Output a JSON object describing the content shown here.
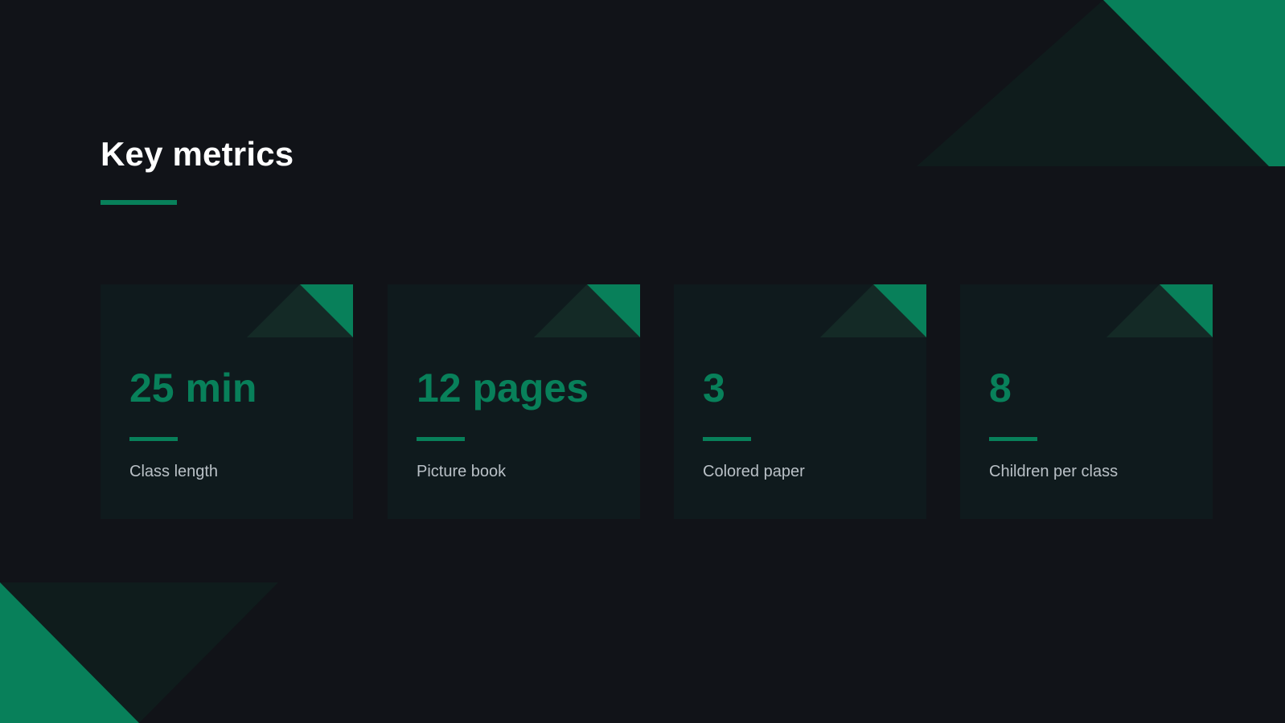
{
  "slide": {
    "title": "Key metrics"
  },
  "colors": {
    "background": "#111318",
    "accent": "#08805a",
    "card": "#0f1a1d",
    "card_shadow": "#142a26",
    "title": "#ffffff",
    "label": "#b9c0c6"
  },
  "metrics": [
    {
      "value": "25 min",
      "label": "Class length"
    },
    {
      "value": "12 pages",
      "label": "Picture book"
    },
    {
      "value": "3",
      "label": "Colored paper"
    },
    {
      "value": "8",
      "label": "Children per class"
    }
  ]
}
